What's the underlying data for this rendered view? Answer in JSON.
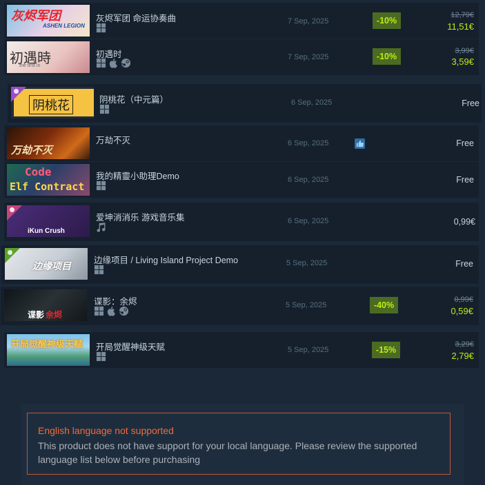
{
  "items": [
    {
      "title": "灰烬军团 命运协奏曲",
      "date": "7 Sep, 2025",
      "discount": "-10%",
      "original_price": "12,79€",
      "final_price": "11,51€",
      "platforms": [
        "windows"
      ],
      "thumb_text": "灰烬军团",
      "thumb_sub": "ASHEN LEGION"
    },
    {
      "title": "初遇时",
      "date": "7 Sep, 2025",
      "discount": "-10%",
      "original_price": "3,99€",
      "final_price": "3,59€",
      "platforms": [
        "windows",
        "mac",
        "steam"
      ],
      "thumb_text": "初遇時",
      "thumb_sub": "the first in"
    },
    {
      "title": "阴桃花（中元篇）",
      "date": "6 Sep, 2025",
      "price": "Free",
      "platforms": [
        "windows"
      ],
      "thumb_text": "阴桃花",
      "badge_color": "#9c4dcc"
    },
    {
      "title": "万劫不灭",
      "date": "6 Sep, 2025",
      "price": "Free",
      "platforms": [],
      "thumb_text": "万劫不灭",
      "thumbs_up": true
    },
    {
      "title": "我的精靈小助理Demo",
      "date": "6 Sep, 2025",
      "price": "Free",
      "platforms": [
        "windows"
      ],
      "thumb_text": "Code",
      "thumb_sub": "Elf Contract"
    },
    {
      "title": "爱坤消消乐 游戏音乐集",
      "date": "6 Sep, 2025",
      "price": "0,99€",
      "platforms": [
        "music"
      ],
      "thumb_text": "iKun Crush",
      "badge_color": "#c2467e"
    },
    {
      "title": "边缘项目 / Living Island Project Demo",
      "date": "5 Sep, 2025",
      "price": "Free",
      "platforms": [
        "windows"
      ],
      "thumb_text": "边缘项目",
      "badge_color": "#5ba32b"
    },
    {
      "title": "谍影：余烬",
      "date": "5 Sep, 2025",
      "discount": "-40%",
      "original_price": "0,99€",
      "final_price": "0,59€",
      "platforms": [
        "windows",
        "mac",
        "steam"
      ],
      "thumb_text": "谍影",
      "thumb_accent": "余烬"
    },
    {
      "title": "开局觉醒神级天赋",
      "date": "5 Sep, 2025",
      "discount": "-15%",
      "original_price": "3,29€",
      "final_price": "2,79€",
      "platforms": [
        "windows"
      ],
      "thumb_text": "开局觉醒神级天赋"
    }
  ],
  "notice": {
    "title": "English language not supported",
    "body": "This product does not have support for your local language. Please review the supported language list below before purchasing"
  },
  "colors": {
    "background": "#1b2838",
    "row": "#16202d",
    "discount_bg": "#4c6b22",
    "discount_text": "#beee11",
    "notice_border": "#c2553a",
    "notice_title": "#f26b3a"
  }
}
